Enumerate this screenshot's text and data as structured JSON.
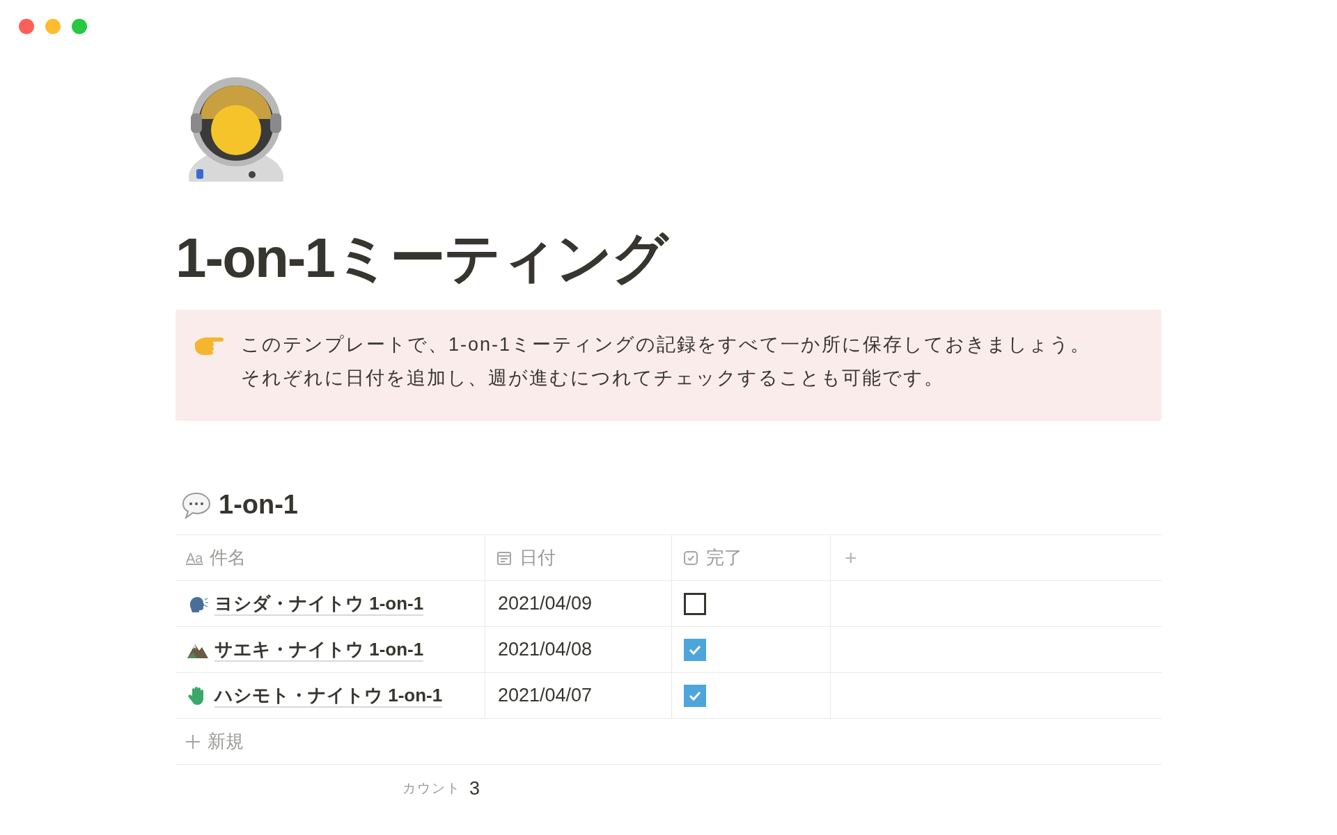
{
  "title": "1-on-1ミーティング",
  "callout": {
    "text": "このテンプレートで、1-on-1ミーティングの記録をすべて一か所に保存しておきましょう。それぞれに日付を追加し、週が進むにつれてチェックすることも可能です。"
  },
  "database": {
    "title": "1-on-1",
    "columns": [
      {
        "kind": "title",
        "icon_text": "Aa",
        "label": "件名"
      },
      {
        "kind": "date",
        "label": "日付"
      },
      {
        "kind": "checkbox",
        "label": "完了"
      }
    ],
    "add_column": "+",
    "rows": [
      {
        "kind": "speaking",
        "name": "ヨシダ・ナイトウ 1-on-1",
        "date": "2021/04/09",
        "checked": false
      },
      {
        "kind": "mountain",
        "name": "サエキ・ナイトウ 1-on-1",
        "date": "2021/04/08",
        "checked": true
      },
      {
        "kind": "glove",
        "name": "ハシモト・ナイトウ 1-on-1",
        "date": "2021/04/07",
        "checked": true
      }
    ],
    "new_row": "新規",
    "count_label": "カウント",
    "count": "3"
  }
}
